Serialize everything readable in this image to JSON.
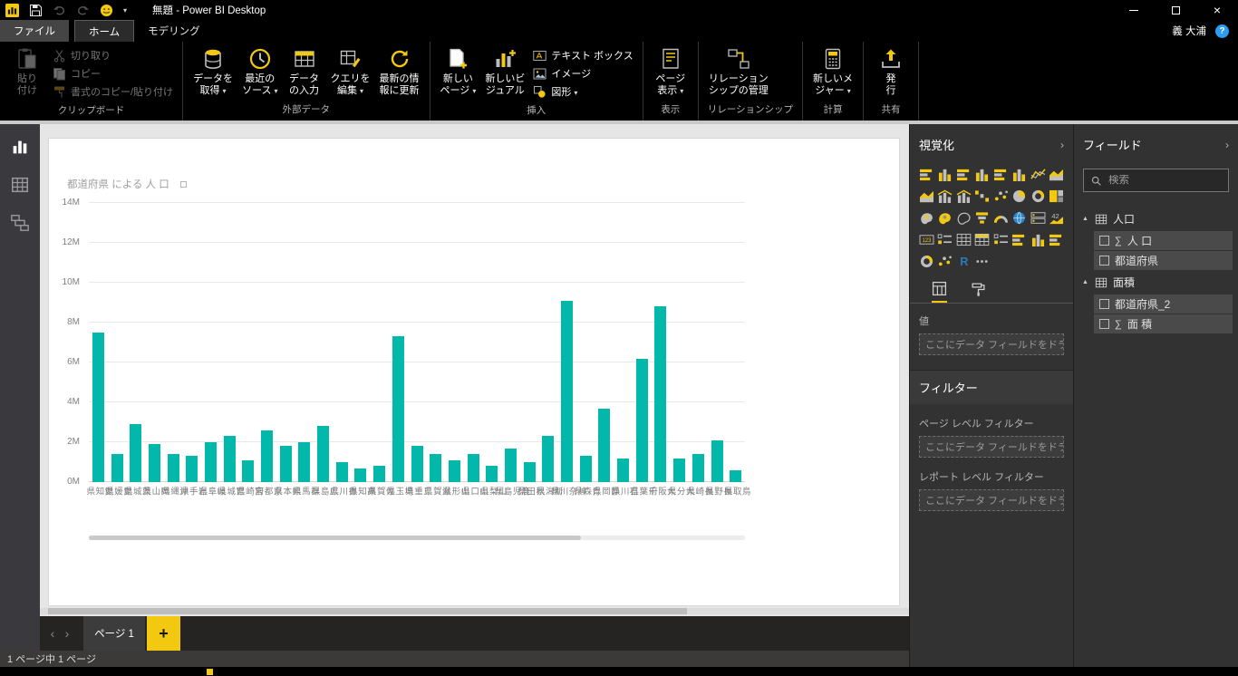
{
  "colors": {
    "accent": "#F2C811",
    "bar": "#01B8AA",
    "help_blue": "#2B9CF2"
  },
  "titlebar": {
    "title": "無題 - Power BI Desktop",
    "close_glyph": "×",
    "caret_glyph": "▾"
  },
  "tabs": {
    "file": "ファイル",
    "home": "ホーム",
    "modeling": "モデリング",
    "user": "義 大浦",
    "help_glyph": "?"
  },
  "ribbon": {
    "caret_glyph": "▾",
    "groups": [
      {
        "label": "クリップボード",
        "buttons": [
          {
            "id": "paste",
            "label": "貼り\n付け",
            "disabled": true
          },
          {
            "id": "cut",
            "label": "切り取り",
            "size": "small",
            "disabled": true
          },
          {
            "id": "copy",
            "label": "コピー",
            "size": "small",
            "disabled": true
          },
          {
            "id": "format-painter",
            "label": "書式のコピー/貼り付け",
            "size": "small",
            "disabled": true
          }
        ]
      },
      {
        "label": "外部データ",
        "buttons": [
          {
            "id": "get-data",
            "label": "データを\n取得",
            "dropdown": true
          },
          {
            "id": "recent-sources",
            "label": "最近の\nソース",
            "dropdown": true
          },
          {
            "id": "enter-data",
            "label": "データ\nの入力"
          },
          {
            "id": "edit-queries",
            "label": "クエリを\n編集",
            "dropdown": true
          },
          {
            "id": "refresh",
            "label": "最新の情\n報に更新"
          }
        ]
      },
      {
        "label": "挿入",
        "buttons": [
          {
            "id": "new-page",
            "label": "新しい\nページ",
            "dropdown": true
          },
          {
            "id": "new-visual",
            "label": "新しいビ\nジュアル"
          },
          {
            "id": "text-box",
            "label": "テキスト ボックス",
            "size": "small"
          },
          {
            "id": "image",
            "label": "イメージ",
            "size": "small"
          },
          {
            "id": "shapes",
            "label": "図形",
            "size": "small",
            "dropdown": true
          }
        ]
      },
      {
        "label": "表示",
        "buttons": [
          {
            "id": "page-view",
            "label": "ページ\n表示",
            "dropdown": true
          }
        ]
      },
      {
        "label": "リレーションシップ",
        "buttons": [
          {
            "id": "manage-relationships",
            "label": "リレーション\nシップの管理"
          }
        ]
      },
      {
        "label": "計算",
        "buttons": [
          {
            "id": "new-measure",
            "label": "新しいメ\nジャー",
            "dropdown": true
          }
        ]
      },
      {
        "label": "共有",
        "buttons": [
          {
            "id": "publish",
            "label": "発\n行"
          }
        ]
      }
    ]
  },
  "sidebar": {
    "views": [
      {
        "id": "report-view",
        "active": true
      },
      {
        "id": "data-view",
        "active": false
      },
      {
        "id": "model-view",
        "active": false
      }
    ]
  },
  "chart_data": {
    "type": "bar",
    "title": "都道府県 による 人 口",
    "xlabel": "",
    "ylabel": "",
    "unit": "M",
    "ylim": [
      0,
      14
    ],
    "y_ticks": [
      0,
      2,
      4,
      6,
      8,
      10,
      12,
      14
    ],
    "grid": true,
    "legend": false,
    "bar_color": "#01B8AA",
    "categories": [
      "愛知県",
      "愛媛県",
      "茨城県",
      "岡山県",
      "沖縄県",
      "岩手県",
      "岐阜県",
      "宮城県",
      "宮崎県",
      "京都府",
      "熊本県",
      "群馬県",
      "広島県",
      "香川県",
      "高知県",
      "佐賀県",
      "埼玉県",
      "三重県",
      "滋賀県",
      "山形県",
      "山口県",
      "山梨県",
      "鹿児島県",
      "秋田県",
      "新潟県",
      "神奈川県",
      "青森県",
      "静岡県",
      "石川県",
      "千葉県",
      "大阪府",
      "大分県",
      "長崎県",
      "長野県",
      "鳥取県"
    ],
    "values": [
      7.5,
      1.4,
      2.9,
      1.9,
      1.4,
      1.3,
      2.0,
      2.3,
      1.1,
      2.6,
      1.8,
      2.0,
      2.8,
      1.0,
      0.7,
      0.8,
      7.3,
      1.8,
      1.4,
      1.1,
      1.4,
      0.8,
      1.7,
      1.0,
      2.3,
      9.1,
      1.3,
      3.7,
      1.2,
      6.2,
      8.8,
      1.2,
      1.4,
      2.1,
      0.6
    ]
  },
  "viz_panel": {
    "title": "視覚化",
    "collapse_glyph": "›",
    "values_label": "値",
    "drop_hint": "ここにデータ フィールドをドラッグし...",
    "icons": [
      "stacked-bar-chart",
      "stacked-column-chart",
      "clustered-bar-chart",
      "clustered-column-chart",
      "100-stacked-bar-chart",
      "100-stacked-column-chart",
      "line-chart",
      "area-chart",
      "stacked-area-chart",
      "line-and-stacked-column-chart",
      "line-and-clustered-column-chart",
      "waterfall-chart",
      "scatter-chart",
      "pie-chart",
      "donut-chart",
      "treemap",
      "map",
      "filled-map",
      "shape-map",
      "funnel",
      "gauge",
      "arcgis-map",
      "multi-row-card",
      "kpi",
      "card",
      "slicer",
      "table",
      "matrix",
      "chiclet-slicer",
      "timeline",
      "histogram",
      "bullet-chart",
      "sunburst",
      "word-cloud",
      "r-script-visual",
      "more-options"
    ]
  },
  "filters": {
    "title": "フィルター",
    "page_level_label": "ページ レベル フィルター",
    "report_level_label": "レポート レベル フィルター",
    "drop_hint": "ここにデータ フィールドをドラッグ..."
  },
  "fields_panel": {
    "title": "フィールド",
    "collapse_glyph": "›",
    "search_placeholder": "検索",
    "sigma_glyph": "∑",
    "expand_glyph": "▲",
    "tables": [
      {
        "name": "人口",
        "fields": [
          {
            "name": "人 口",
            "numeric": true
          },
          {
            "name": "都道府県",
            "numeric": false
          }
        ]
      },
      {
        "name": "面積",
        "fields": [
          {
            "name": "都道府県_2",
            "numeric": false
          },
          {
            "name": "面 積",
            "numeric": true
          }
        ]
      }
    ]
  },
  "page_tabs": {
    "current": "ページ 1",
    "add_glyph": "+",
    "prev_glyph": "‹",
    "next_glyph": "›"
  },
  "statusbar": {
    "text": "1 ページ中 1 ページ"
  }
}
